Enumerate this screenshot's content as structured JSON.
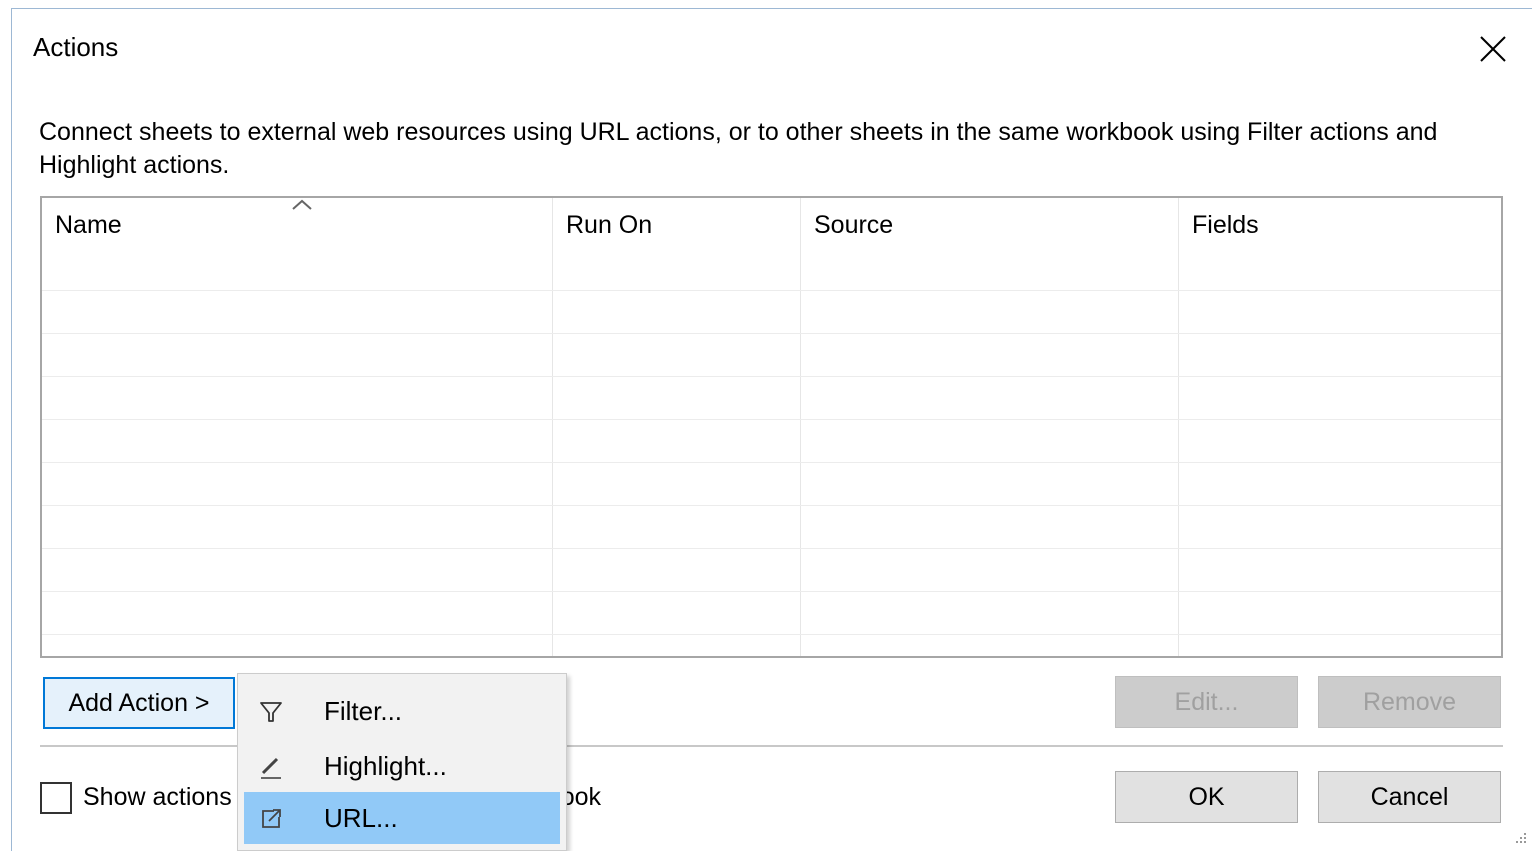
{
  "dialog": {
    "title": "Actions",
    "description": "Connect sheets to external web resources using URL actions, or to other sheets in the same workbook using Filter actions and Highlight actions."
  },
  "table": {
    "columns": [
      "Name",
      "Run On",
      "Source",
      "Fields"
    ],
    "rows": []
  },
  "buttons": {
    "add_action": "Add Action >",
    "edit": "Edit...",
    "remove": "Remove",
    "ok": "OK",
    "cancel": "Cancel"
  },
  "checkbox": {
    "label_left": "Show actions",
    "label_right": "ook",
    "checked": false
  },
  "add_menu": {
    "items": [
      {
        "label": "Filter...",
        "icon": "filter-icon"
      },
      {
        "label": "Highlight...",
        "icon": "highlight-pen-icon"
      },
      {
        "label": "URL...",
        "icon": "external-link-icon",
        "selected": true
      }
    ]
  },
  "colors": {
    "accent": "#0078d7",
    "menu_selected": "#91c9f7",
    "button_face": "#e1e1e1",
    "disabled_text": "#a0a0a0"
  }
}
